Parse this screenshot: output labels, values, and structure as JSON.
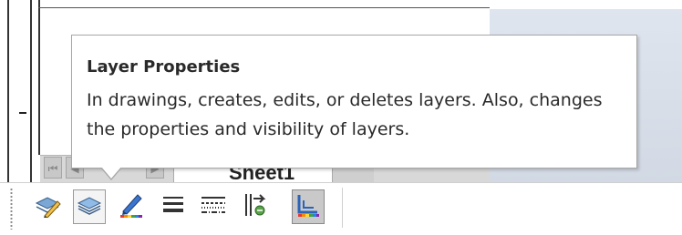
{
  "tooltip": {
    "title": "Layer Properties",
    "description": "In drawings, creates, edits, or deletes layers. Also, changes the properties and visibility of layers."
  },
  "sheet_tab": {
    "label": "Sheet1"
  },
  "navigation": {
    "first_glyph": "⏮",
    "prev_glyph": "◀",
    "next_glyph": "▶"
  },
  "toolbar": {
    "buttons": [
      {
        "icon": "layer-pencil-icon"
      },
      {
        "icon": "layer-properties-icon"
      },
      {
        "icon": "line-color-icon"
      },
      {
        "icon": "line-thickness-icon"
      },
      {
        "icon": "line-style-icon"
      },
      {
        "icon": "hide-show-edges-icon"
      },
      {
        "icon": "color-display-mode-icon"
      }
    ]
  },
  "colors": {
    "accent_blue": "#3a76d0",
    "tooltip_border": "#a7a7a7",
    "drawing_bg": "#d8dfe9"
  }
}
